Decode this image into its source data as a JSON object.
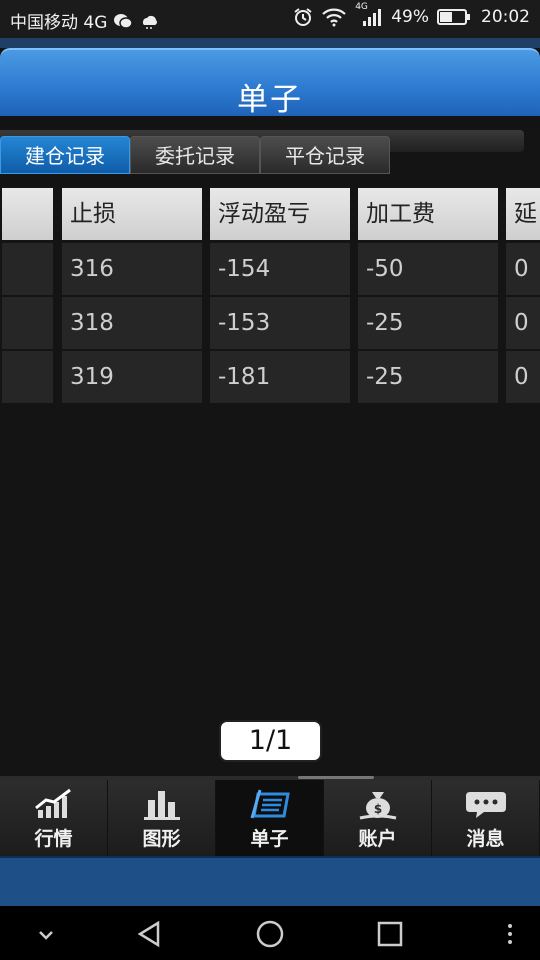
{
  "status_bar": {
    "carrier": "中国移动 4G",
    "network_badge": "4G",
    "battery_text": "49%",
    "battery_level": 0.49,
    "time": "20:02",
    "icons": [
      "wechat-icon",
      "cloud-icon",
      "alarm-icon",
      "wifi-icon",
      "signal-icon",
      "battery-icon"
    ]
  },
  "title_bar": {
    "title": "单子"
  },
  "tabs": [
    {
      "label": "建仓记录",
      "active": true
    },
    {
      "label": "委托记录",
      "active": false
    },
    {
      "label": "平仓记录",
      "active": false
    }
  ],
  "table": {
    "headers": [
      "",
      "止损",
      "浮动盈亏",
      "加工费",
      "延"
    ],
    "rows": [
      [
        "",
        "316",
        "-154",
        "-50",
        "0"
      ],
      [
        "",
        "318",
        "-153",
        "-25",
        "0"
      ],
      [
        "",
        "319",
        "-181",
        "-25",
        "0"
      ]
    ]
  },
  "pager": {
    "text": "1/1"
  },
  "bottom_nav": [
    {
      "label": "行情",
      "icon": "market-chart-icon",
      "active": false
    },
    {
      "label": "图形",
      "icon": "bar-chart-icon",
      "active": false
    },
    {
      "label": "单子",
      "icon": "order-list-icon",
      "active": true
    },
    {
      "label": "账户",
      "icon": "money-bag-icon",
      "active": false
    },
    {
      "label": "消息",
      "icon": "message-bubble-icon",
      "active": false
    }
  ],
  "system_nav": [
    "collapse-icon",
    "back-icon",
    "home-icon",
    "recents-icon",
    "more-icon"
  ],
  "colors": {
    "accent_blue": "#2d7cd2",
    "active_tab": "#1873c4",
    "background": "#131313"
  }
}
